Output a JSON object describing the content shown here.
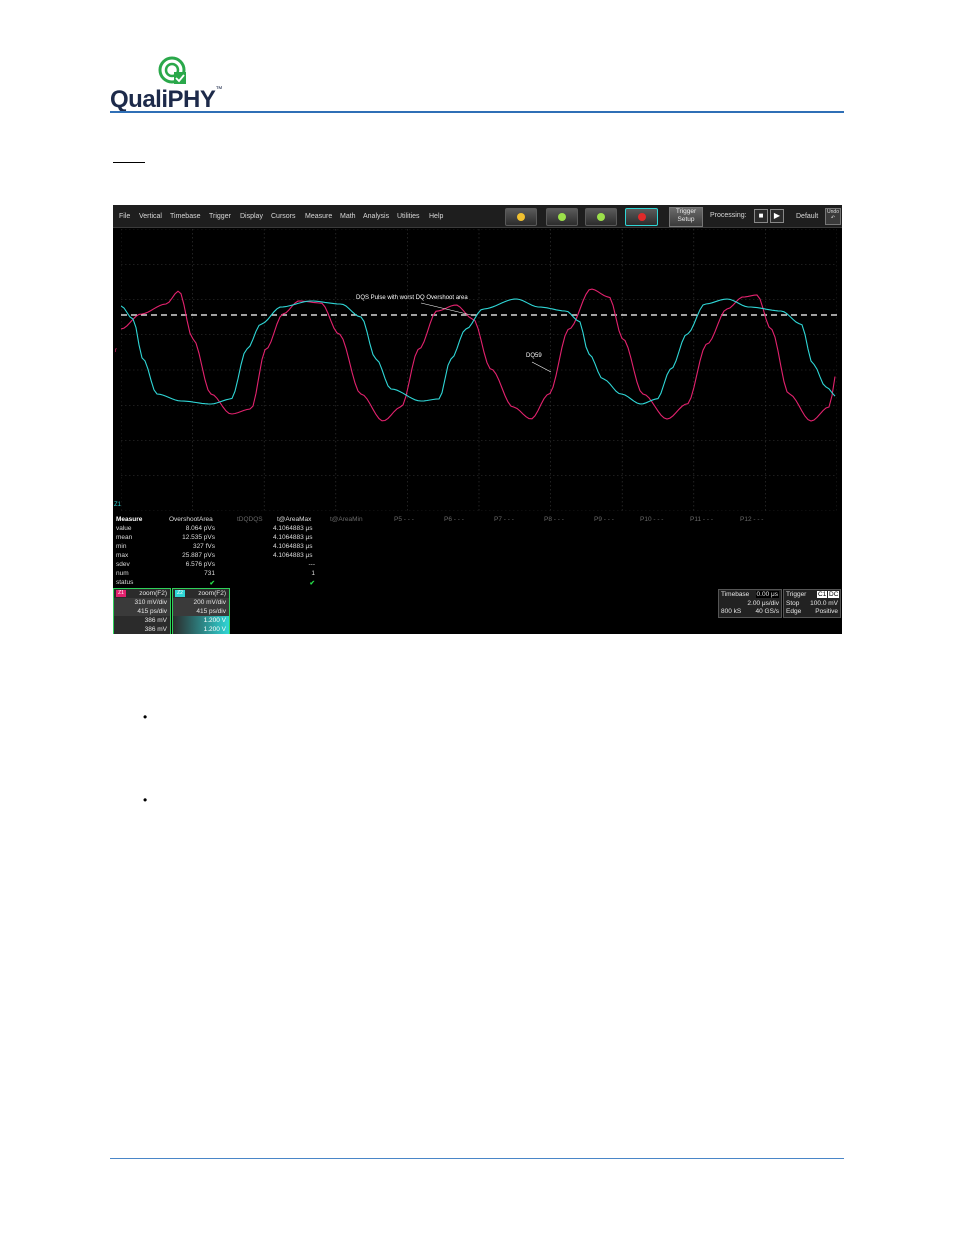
{
  "document": {
    "logo": {
      "brand": "QualiPHY",
      "trademark": "™"
    },
    "bullets": [
      "•",
      "•"
    ]
  },
  "scope": {
    "menu": [
      "File",
      "Vertical",
      "Timebase",
      "Trigger",
      "Display",
      "Cursors",
      "Measure",
      "Math",
      "Analysis",
      "Utilities",
      "Help"
    ],
    "toolbar": {
      "trigger_setup_line1": "Trigger",
      "trigger_setup_line2": "Setup",
      "processing_label": "Processing:",
      "stop_glyph": "■",
      "run_glyph": "▶",
      "default_label": "Default",
      "undo_label": "Undo"
    },
    "colors": {
      "ch_pink": "#e3226e",
      "ch_cyan": "#2fd6d6",
      "status_green": "#27e04a"
    },
    "channel_marker_top": "r",
    "channel_marker_bottom": "Z1",
    "annotations": {
      "overshoot": "DQS Pulse with worst DQ Overshoot area",
      "dq": "DQ59"
    },
    "measure": {
      "headers": [
        "Measure",
        "OvershootArea",
        "tDQDQS",
        "t@AreaMax",
        "t@AreaMin",
        "P5 - - -",
        "P6 - - -",
        "P7 - - -",
        "P8 - - -",
        "P9 - - -",
        "P10 - - -",
        "P11 - - -",
        "P12 - - -"
      ],
      "rows": [
        {
          "label": "value",
          "p1": "8.064 pVs",
          "p3": "4.1064883 μs"
        },
        {
          "label": "mean",
          "p1": "12.535 pVs",
          "p3": "4.1064883 μs"
        },
        {
          "label": "min",
          "p1": "327 fVs",
          "p3": "4.1064883 μs"
        },
        {
          "label": "max",
          "p1": "25.887 pVs",
          "p3": "4.1064883 μs"
        },
        {
          "label": "sdev",
          "p1": "6.576 pVs",
          "p3": "---"
        },
        {
          "label": "num",
          "p1": "731",
          "p3": "1"
        },
        {
          "label": "status",
          "p1": "✔",
          "p3": "✔"
        }
      ]
    },
    "zoom_boxes": [
      {
        "tag": "Z1",
        "name": "zoom(F2)",
        "vdiv": "310 mV/div",
        "tdiv": "415 ps/div",
        "v1": "386 mV",
        "v2": "386 mV",
        "tag_color": "#e3226e"
      },
      {
        "tag": "Z2",
        "name": "zoom(F2)",
        "vdiv": "200 mV/div",
        "tdiv": "415 ps/div",
        "v1": "1.200 V",
        "v2": "1.200 V",
        "tag_color": "#2fd6d6"
      }
    ],
    "timebase": {
      "label": "Timebase",
      "delay": "0.00 μs",
      "tdiv": "2.00 μs/div",
      "samples": "800 kS",
      "rate": "40 GS/s"
    },
    "trigger": {
      "label": "Trigger",
      "ch": "C1",
      "coupling": "DC",
      "mode": "Stop",
      "level": "100.0 mV",
      "type": "Edge",
      "slope": "Positive"
    }
  }
}
